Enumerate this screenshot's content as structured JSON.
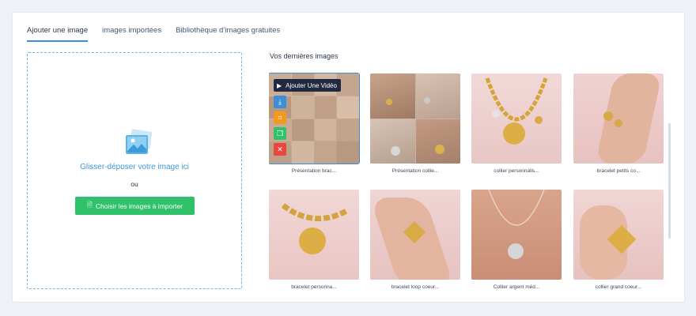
{
  "tabs": [
    {
      "label": "Ajouter une image",
      "active": true
    },
    {
      "label": "images importées",
      "active": false
    },
    {
      "label": "Bibliothèque d’images gratuites",
      "active": false
    }
  ],
  "upload": {
    "title": "Glisser-déposer votre image ici",
    "or": "ou",
    "button_label": "Choisir les images à importer"
  },
  "recent": {
    "title": "Vos dernières images",
    "overlay_label": "Ajouter Une Vidéo",
    "items": [
      {
        "caption": "Présentation brac..."
      },
      {
        "caption": "Présentation collie..."
      },
      {
        "caption": "collier personnalis..."
      },
      {
        "caption": "bracelet petits co..."
      },
      {
        "caption": "bracelet personna..."
      },
      {
        "caption": "bracelet loop coeur..."
      },
      {
        "caption": "Collier argent méd..."
      },
      {
        "caption": "collier grand coeur..."
      }
    ]
  },
  "colors": {
    "accent": "#3d8ed6",
    "button_green": "#2fc26a",
    "dropzone_border": "#7bb6e3"
  }
}
